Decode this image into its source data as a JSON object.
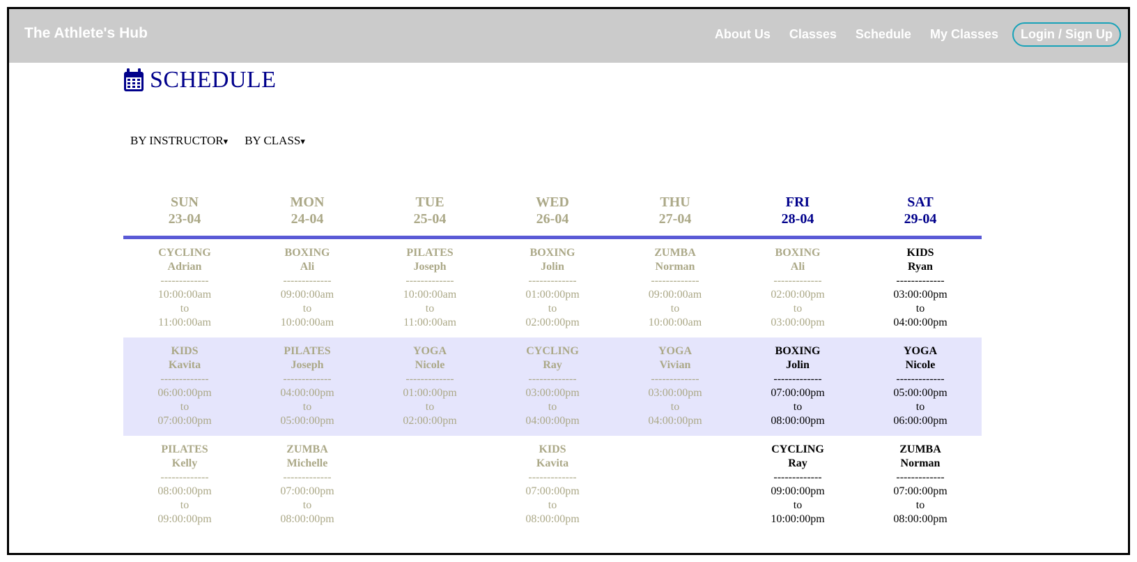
{
  "nav": {
    "brand": "The Athlete's Hub",
    "links": [
      "About Us",
      "Classes",
      "Schedule",
      "My Classes"
    ],
    "login": "Login / Sign Up"
  },
  "page": {
    "title": "SCHEDULE",
    "filters": [
      "BY INSTRUCTOR",
      "BY CLASS"
    ],
    "filter_arrow": "▾"
  },
  "days": [
    {
      "name": "SUN",
      "date": "23-04",
      "active": false
    },
    {
      "name": "MON",
      "date": "24-04",
      "active": false
    },
    {
      "name": "TUE",
      "date": "25-04",
      "active": false
    },
    {
      "name": "WED",
      "date": "26-04",
      "active": false
    },
    {
      "name": "THU",
      "date": "27-04",
      "active": false
    },
    {
      "name": "FRI",
      "date": "28-04",
      "active": true
    },
    {
      "name": "SAT",
      "date": "29-04",
      "active": true
    }
  ],
  "separator": "-------------",
  "to_text": "to",
  "rows": [
    [
      {
        "cls": "CYCLING",
        "inst": "Adrian",
        "start": "10:00:00am",
        "end": "11:00:00am",
        "active": false
      },
      {
        "cls": "BOXING",
        "inst": "Ali",
        "start": "09:00:00am",
        "end": "10:00:00am",
        "active": false
      },
      {
        "cls": "PILATES",
        "inst": "Joseph",
        "start": "10:00:00am",
        "end": "11:00:00am",
        "active": false
      },
      {
        "cls": "BOXING",
        "inst": "Jolin",
        "start": "01:00:00pm",
        "end": "02:00:00pm",
        "active": false
      },
      {
        "cls": "ZUMBA",
        "inst": "Norman",
        "start": "09:00:00am",
        "end": "10:00:00am",
        "active": false
      },
      {
        "cls": "BOXING",
        "inst": "Ali",
        "start": "02:00:00pm",
        "end": "03:00:00pm",
        "active": false
      },
      {
        "cls": "KIDS",
        "inst": "Ryan",
        "start": "03:00:00pm",
        "end": "04:00:00pm",
        "active": true
      }
    ],
    [
      {
        "cls": "KIDS",
        "inst": "Kavita",
        "start": "06:00:00pm",
        "end": "07:00:00pm",
        "active": false
      },
      {
        "cls": "PILATES",
        "inst": "Joseph",
        "start": "04:00:00pm",
        "end": "05:00:00pm",
        "active": false
      },
      {
        "cls": "YOGA",
        "inst": "Nicole",
        "start": "01:00:00pm",
        "end": "02:00:00pm",
        "active": false
      },
      {
        "cls": "CYCLING",
        "inst": "Ray",
        "start": "03:00:00pm",
        "end": "04:00:00pm",
        "active": false
      },
      {
        "cls": "YOGA",
        "inst": "Vivian",
        "start": "03:00:00pm",
        "end": "04:00:00pm",
        "active": false
      },
      {
        "cls": "BOXING",
        "inst": "Jolin",
        "start": "07:00:00pm",
        "end": "08:00:00pm",
        "active": true
      },
      {
        "cls": "YOGA",
        "inst": "Nicole",
        "start": "05:00:00pm",
        "end": "06:00:00pm",
        "active": true
      }
    ],
    [
      {
        "cls": "PILATES",
        "inst": "Kelly",
        "start": "08:00:00pm",
        "end": "09:00:00pm",
        "active": false
      },
      {
        "cls": "ZUMBA",
        "inst": "Michelle",
        "start": "07:00:00pm",
        "end": "08:00:00pm",
        "active": false
      },
      null,
      {
        "cls": "KIDS",
        "inst": "Kavita",
        "start": "07:00:00pm",
        "end": "08:00:00pm",
        "active": false
      },
      null,
      {
        "cls": "CYCLING",
        "inst": "Ray",
        "start": "09:00:00pm",
        "end": "10:00:00pm",
        "active": true
      },
      {
        "cls": "ZUMBA",
        "inst": "Norman",
        "start": "07:00:00pm",
        "end": "08:00:00pm",
        "active": true
      }
    ]
  ]
}
